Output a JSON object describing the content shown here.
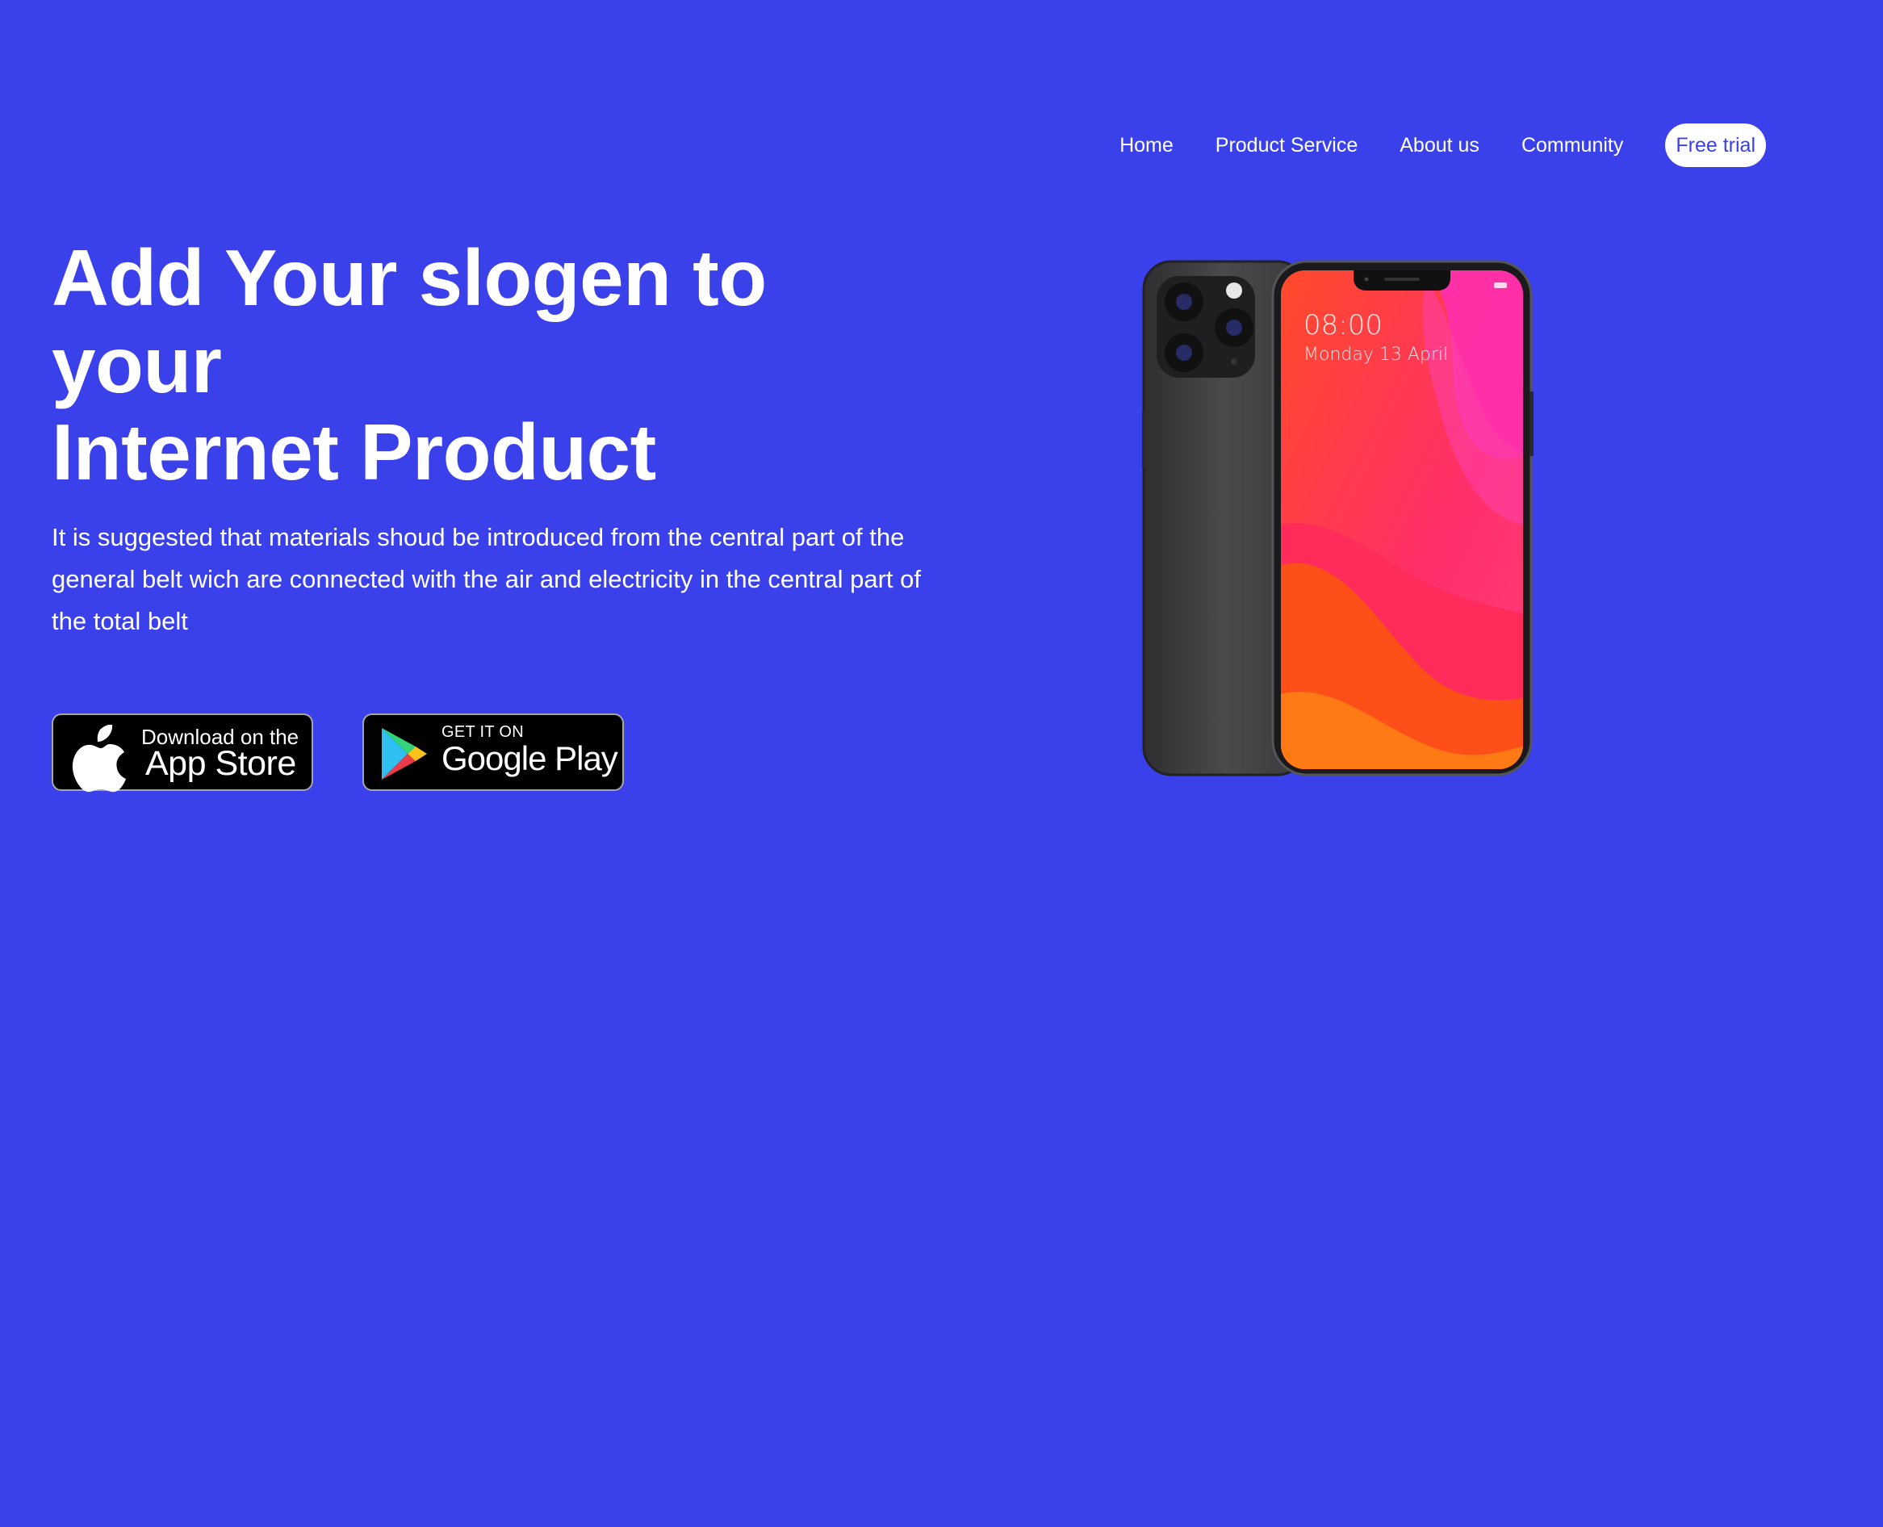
{
  "nav": {
    "links": [
      "Home",
      "Product Service",
      "About us",
      "Community"
    ],
    "cta": "Free trial"
  },
  "hero": {
    "title_lines": [
      "Add Your slogen to",
      "your",
      "Internet Product"
    ],
    "description": "It is suggested that materials shoud be introduced from the central part of the general belt wich are connected with the air and electricity in the central part of the total belt"
  },
  "badges": {
    "appstore": {
      "small": "Download on the",
      "big": "App Store"
    },
    "googleplay": {
      "small": "GET IT ON",
      "big": "Google Play"
    }
  },
  "phone": {
    "time": "08:00",
    "date": "Monday 13 April"
  },
  "colors": {
    "background": "#3a41ea",
    "text": "#ffffff",
    "cta_text": "#3a41ea"
  }
}
